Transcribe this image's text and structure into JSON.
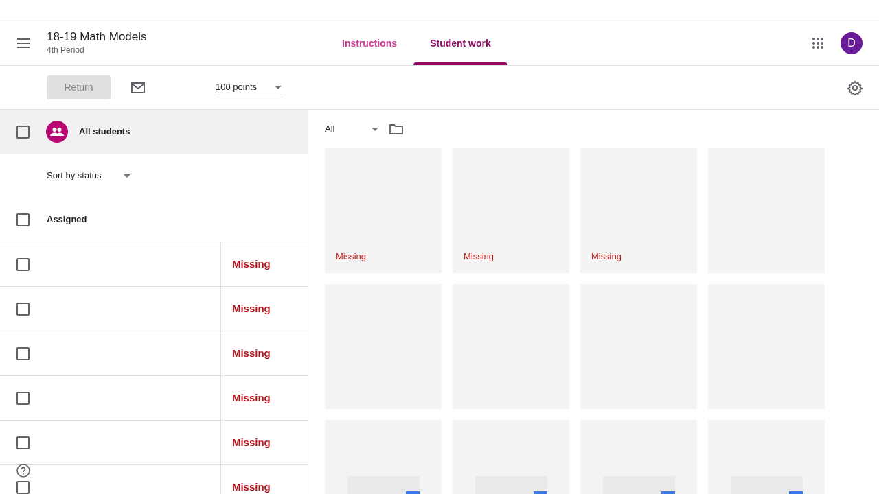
{
  "header": {
    "title": "18-19 Math Models",
    "subtitle": "4th Period"
  },
  "tabs": [
    {
      "label": "Instructions",
      "selected": false
    },
    {
      "label": "Student work",
      "selected": true
    }
  ],
  "account": {
    "initial": "D"
  },
  "toolbar": {
    "return_button": {
      "label": "Return",
      "disabled": true
    },
    "points": "100 points"
  },
  "students": {
    "all_label": "All students",
    "all_checked": false,
    "sort": "Sort by status",
    "group": {
      "label": "Assigned",
      "checked": false
    },
    "rows": [
      {
        "status": "Missing",
        "checked": false
      },
      {
        "status": "Missing",
        "checked": false
      },
      {
        "status": "Missing",
        "checked": false
      },
      {
        "status": "Missing",
        "checked": false
      },
      {
        "status": "Missing",
        "checked": false
      },
      {
        "status": "Missing",
        "checked": false
      }
    ]
  },
  "gallery": {
    "filter": "All",
    "cards": [
      {
        "kind": "blank",
        "status": "Missing"
      },
      {
        "kind": "blank",
        "status": "Missing"
      },
      {
        "kind": "blank",
        "status": "Missing"
      },
      {
        "kind": "blank"
      },
      {
        "kind": "blank"
      },
      {
        "kind": "blank"
      },
      {
        "kind": "blank"
      },
      {
        "kind": "blank"
      },
      {
        "kind": "thumbnail"
      },
      {
        "kind": "thumbnail"
      },
      {
        "kind": "thumbnail"
      },
      {
        "kind": "thumbnail"
      }
    ]
  }
}
